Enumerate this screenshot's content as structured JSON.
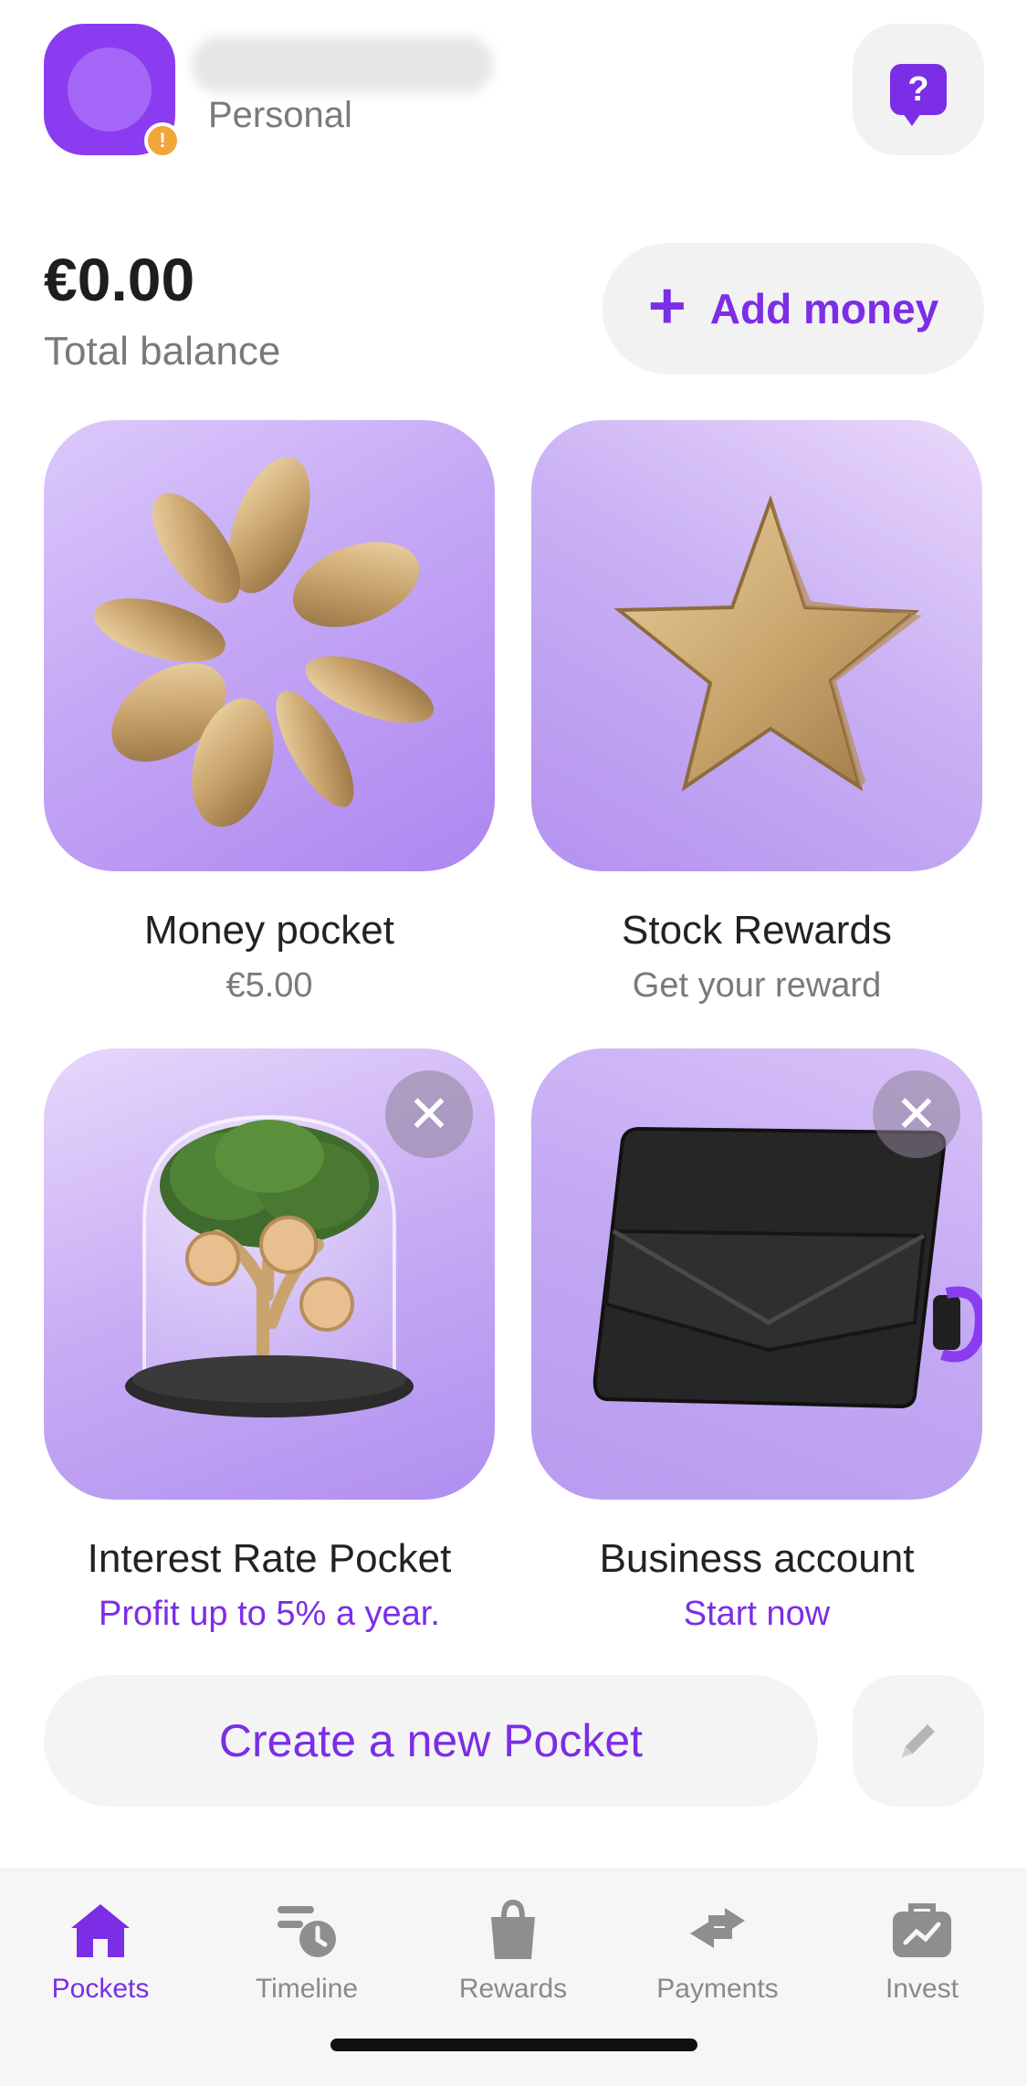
{
  "header": {
    "account_type": "Personal",
    "avatar_badge": "!",
    "help_icon": "question-bubble-icon"
  },
  "balance": {
    "amount": "€0.00",
    "label": "Total balance",
    "add_money_label": "Add money"
  },
  "pockets": [
    {
      "title": "Money pocket",
      "subtitle": "€5.00",
      "illustration": "gold-coins-icon",
      "dismissible": false
    },
    {
      "title": "Stock Rewards",
      "subtitle": "Get your reward",
      "illustration": "gold-star-icon",
      "dismissible": false
    },
    {
      "title": "Interest Rate Pocket",
      "subtitle": "Profit up to 5% a year.",
      "illustration": "money-tree-icon",
      "dismissible": true
    },
    {
      "title": "Business account",
      "subtitle": "Start now",
      "illustration": "wallet-icon",
      "dismissible": true
    }
  ],
  "create_pocket_label": "Create a new Pocket",
  "nav": {
    "items": [
      {
        "label": "Pockets",
        "icon": "home-icon",
        "active": true
      },
      {
        "label": "Timeline",
        "icon": "timeline-icon",
        "active": false
      },
      {
        "label": "Rewards",
        "icon": "shopping-bag-icon",
        "active": false
      },
      {
        "label": "Payments",
        "icon": "transfer-arrows-icon",
        "active": false
      },
      {
        "label": "Invest",
        "icon": "briefcase-chart-icon",
        "active": false
      }
    ]
  },
  "colors": {
    "accent": "#7b2ee6",
    "avatar": "#8b3cf0",
    "badge": "#f1a63a",
    "muted_text": "#7a7a7a",
    "button_bg": "#f2f2f2"
  }
}
